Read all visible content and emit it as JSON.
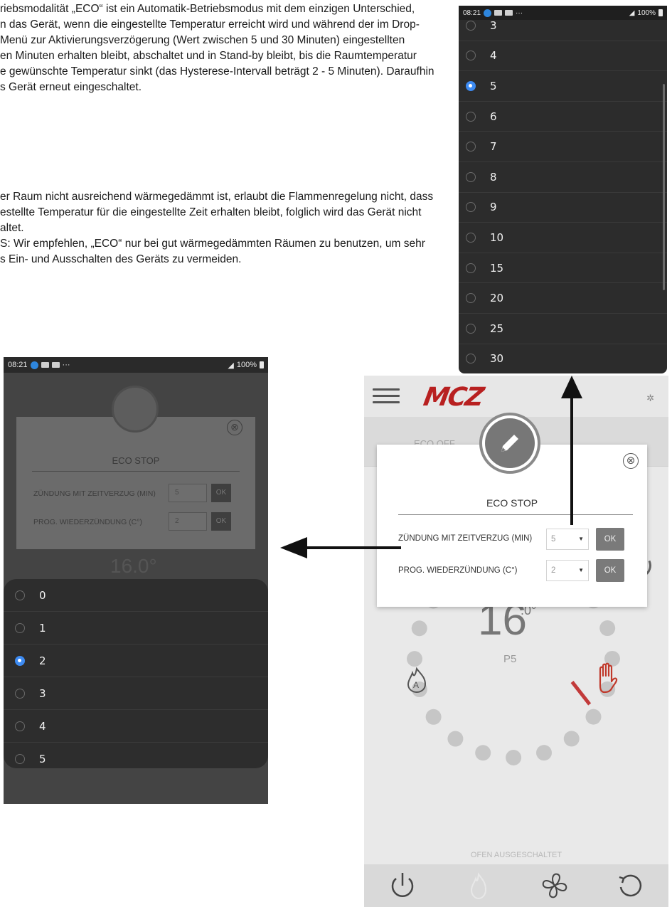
{
  "manual": {
    "para1": [
      "riebsmodalität „ECO“ ist ein Automatik-Betriebsmodus mit dem einzigen Unterschied,",
      "n das Gerät, wenn die eingestellte Temperatur erreicht wird und während der im Drop-",
      "Menü zur Aktivierungsverzögerung (Wert zwischen 5 und 30 Minuten) eingestellten",
      "en Minuten erhalten bleibt, abschaltet und in Stand-by bleibt, bis die Raumtemperatur",
      "e gewünschte Temperatur sinkt (das Hysterese-Intervall beträgt 2 - 5 Minuten). Daraufhin",
      "s Gerät erneut eingeschaltet."
    ],
    "para2": [
      "er Raum nicht ausreichend wärmegedämmt ist, erlaubt die Flammenregelung nicht, dass",
      "estellte Temperatur für die eingestellte Zeit erhalten bleibt, folglich wird das Gerät nicht",
      "altet.",
      "S: Wir empfehlen, „ECO“ nur bei gut wärmegedämmten Räumen zu benutzen, um sehr",
      "s Ein- und Ausschalten des Geräts zu vermeiden."
    ]
  },
  "status_bar": {
    "time": "08:21",
    "dots": "···",
    "signal_battery": "100%"
  },
  "picker_top": {
    "items": [
      {
        "label": "3",
        "checked": false
      },
      {
        "label": "4",
        "checked": false
      },
      {
        "label": "5",
        "checked": true
      },
      {
        "label": "6",
        "checked": false
      },
      {
        "label": "7",
        "checked": false
      },
      {
        "label": "8",
        "checked": false
      },
      {
        "label": "9",
        "checked": false
      },
      {
        "label": "10",
        "checked": false
      },
      {
        "label": "15",
        "checked": false
      },
      {
        "label": "20",
        "checked": false
      },
      {
        "label": "25",
        "checked": false
      },
      {
        "label": "30",
        "checked": false
      }
    ]
  },
  "picker_left": {
    "items": [
      {
        "label": "0",
        "checked": false
      },
      {
        "label": "1",
        "checked": false
      },
      {
        "label": "2",
        "checked": true
      },
      {
        "label": "3",
        "checked": false
      },
      {
        "label": "4",
        "checked": false
      },
      {
        "label": "5",
        "checked": false
      }
    ]
  },
  "dim_modal": {
    "title": "ECO STOP",
    "row1_label": "ZÜNDUNG MIT ZEITVERZUG (MIN)",
    "row1_value": "5",
    "row2_label": "PROG. WIEDERZÜNDUNG (C°)",
    "row2_value": "2",
    "ok": "OK",
    "close": "⊗",
    "temp": "16.0°"
  },
  "app": {
    "logo": "MCZ",
    "tab_left": "ECO OFF",
    "temperature": "16",
    "temperature_decimal": ".0°",
    "power_level": "P5",
    "status_text": "OFEN AUSGESCHALTET",
    "accent_color": "#b82020"
  },
  "eco_modal": {
    "title": "ECO STOP",
    "close": "⊗",
    "row1_label": "ZÜNDUNG MIT ZEITVERZUG (MIN)",
    "row1_value": "5",
    "row2_label": "PROG. WIEDERZÜNDUNG (C°)",
    "row2_value": "2",
    "ok_label": "OK"
  }
}
